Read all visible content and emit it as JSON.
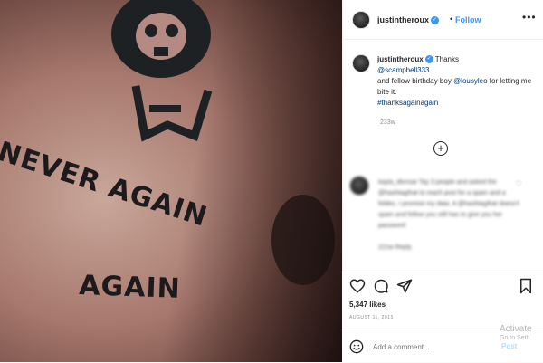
{
  "header": {
    "username": "justintheroux",
    "follow_label": "Follow",
    "more_icon": "more-horizontal-icon"
  },
  "photo": {
    "tattoo_line1": "NEVER AGAIN",
    "tattoo_line2": "AGAIN"
  },
  "caption": {
    "username": "justintheroux",
    "text_1": "Thanks",
    "mention_1": "@scampbell333",
    "text_2": "and fellow birthday boy",
    "mention_2": "@lousyleo",
    "text_3": "for letting me bite it.",
    "hashtag": "#thanksagainagain",
    "time": "233w"
  },
  "load_more_label": "+",
  "blurred_comment": {
    "text": "kayla_dlonsar Tay 3 people and asked the @hashtagthat to reach post for a spam and a foldes. I promise my data. A @hashtagthat doesn't spam and follow you still has to give you her password",
    "meta": "221w   Reply"
  },
  "actions": {
    "likes": "5,347 likes",
    "date": "AUGUST 11, 2015"
  },
  "comment_box": {
    "placeholder": "Add a comment...",
    "post_label": "Post"
  },
  "watermark": {
    "line1": "Activate",
    "line2": "Go to Setti"
  },
  "colors": {
    "accent": "#3897f0",
    "link": "#00376b",
    "muted": "#8e8e8e",
    "border": "#efefef"
  }
}
